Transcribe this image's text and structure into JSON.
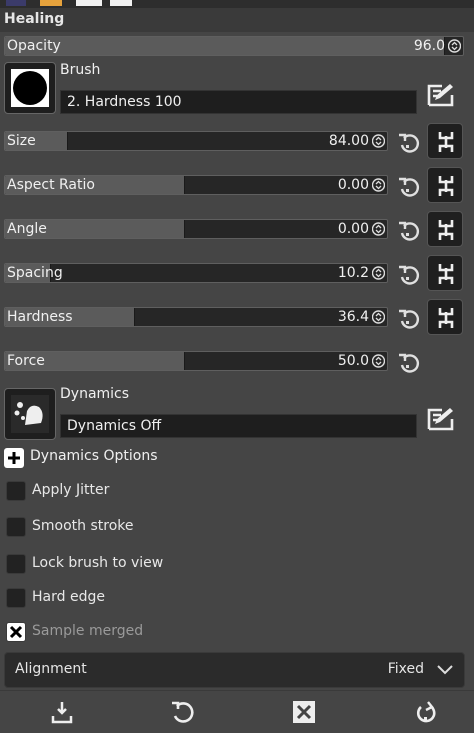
{
  "panel": {
    "title": "Healing"
  },
  "opacity": {
    "label": "Opacity",
    "value": "96.0",
    "fraction": 0.96
  },
  "brush": {
    "label": "Brush",
    "name": "2. Hardness 100"
  },
  "sliders": [
    {
      "label": "Size",
      "value": "84.00",
      "fraction": 0.165
    },
    {
      "label": "Aspect Ratio",
      "value": "0.00",
      "fraction": 0.47
    },
    {
      "label": "Angle",
      "value": "0.00",
      "fraction": 0.47
    },
    {
      "label": "Spacing",
      "value": "10.2",
      "fraction": 0.12
    },
    {
      "label": "Hardness",
      "value": "36.4",
      "fraction": 0.34
    },
    {
      "label": "Force",
      "value": "50.0",
      "fraction": 0.47
    }
  ],
  "dynamics": {
    "label": "Dynamics",
    "name": "Dynamics Off"
  },
  "dynamics_options": {
    "label": "Dynamics Options"
  },
  "options": [
    {
      "label": "Apply Jitter",
      "checked": false
    },
    {
      "label": "Smooth stroke",
      "checked": false
    },
    {
      "label": "Lock brush to view",
      "checked": false
    },
    {
      "label": "Hard edge",
      "checked": false
    },
    {
      "label": "Sample merged",
      "checked": true
    }
  ],
  "alignment": {
    "label": "Alignment",
    "value": "Fixed"
  },
  "icons": {
    "reset": "reset-icon",
    "chain": "chain-link-icon",
    "edit": "edit-icon",
    "save": "save-preset-icon",
    "restore": "restore-icon",
    "delete": "delete-icon",
    "reset_all": "reset-defaults-icon"
  },
  "colors": {
    "background": "#454545",
    "slider_fill": "#5b5b5b",
    "slider_bg": "#262626",
    "field_bg": "#1e1e1e"
  }
}
